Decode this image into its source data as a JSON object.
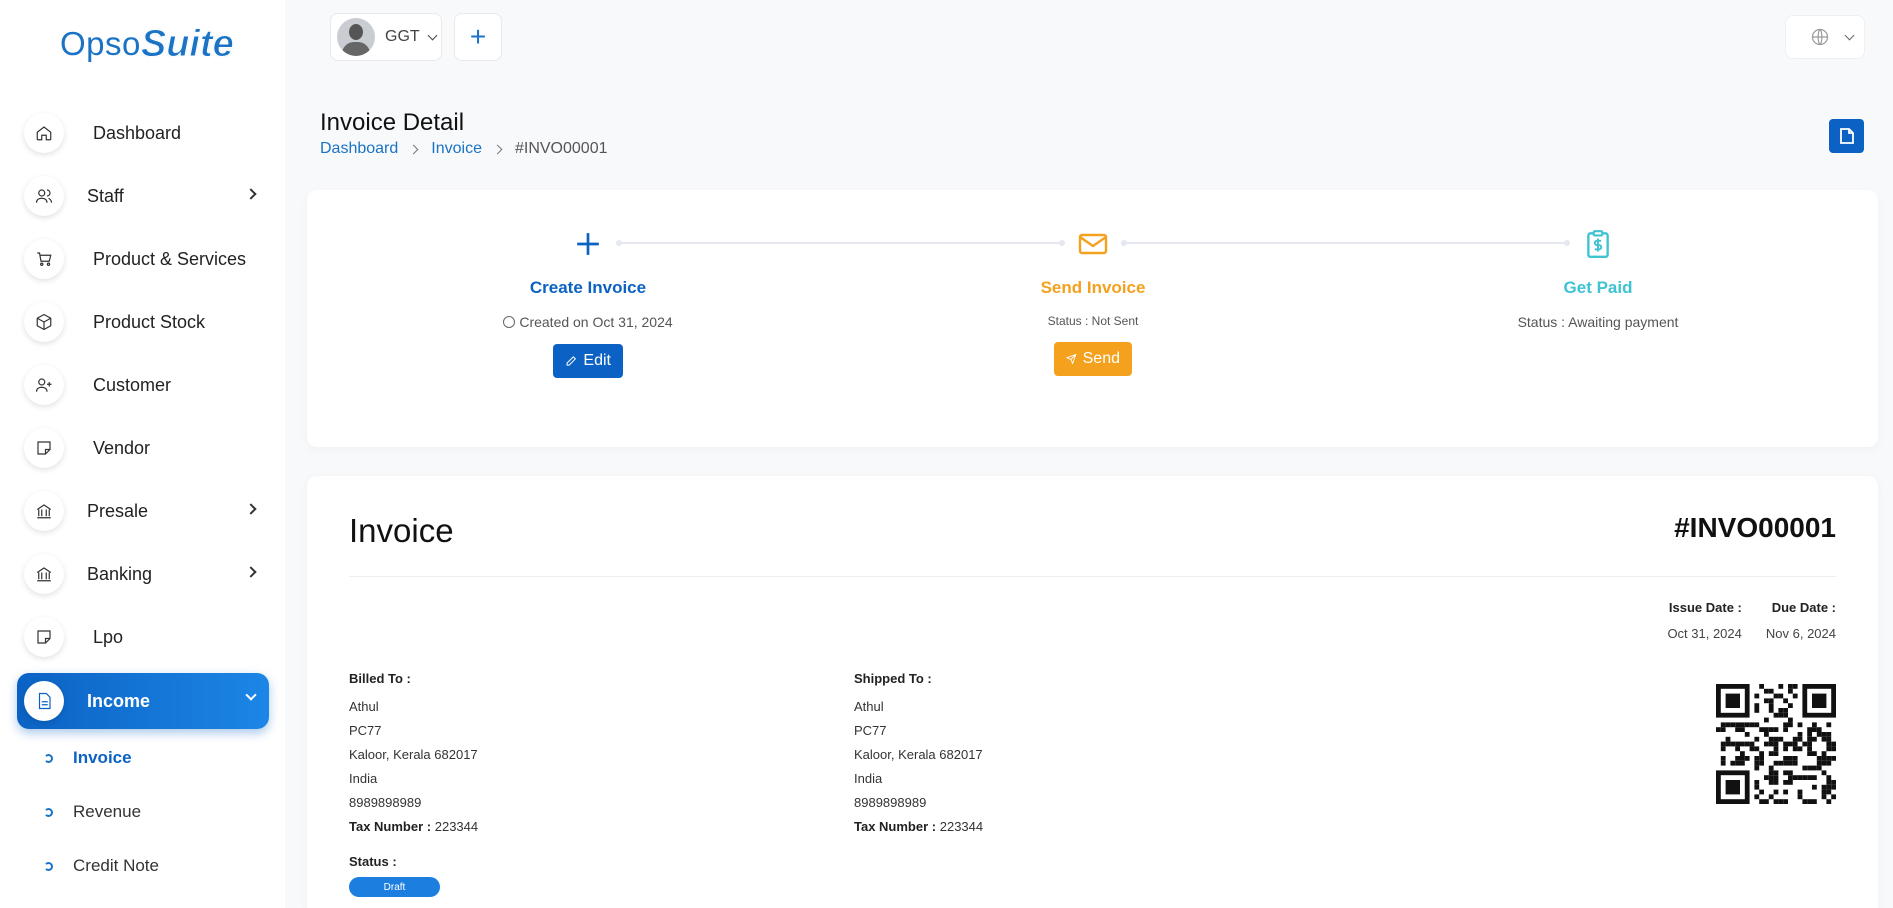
{
  "app": {
    "logo_part1": "Opso",
    "logo_part2": "Suite"
  },
  "topbar": {
    "company_name": "GGT",
    "add_label": "+"
  },
  "sidebar": {
    "items": [
      {
        "label": "Dashboard",
        "icon": "home-icon"
      },
      {
        "label": "Staff",
        "icon": "users-icon",
        "has_children": true
      },
      {
        "label": "Product & Services",
        "icon": "cart-icon"
      },
      {
        "label": "Product Stock",
        "icon": "box-icon"
      },
      {
        "label": "Customer",
        "icon": "user-plus-icon"
      },
      {
        "label": "Vendor",
        "icon": "note-icon"
      },
      {
        "label": "Presale",
        "icon": "bank-icon",
        "has_children": true
      },
      {
        "label": "Banking",
        "icon": "bank-icon",
        "has_children": true
      },
      {
        "label": "Lpo",
        "icon": "note-icon"
      },
      {
        "label": "Income",
        "icon": "file-icon",
        "has_children": true,
        "active": true
      }
    ],
    "subitems": [
      {
        "label": "Invoice",
        "active": true
      },
      {
        "label": "Revenue"
      },
      {
        "label": "Credit Note"
      }
    ]
  },
  "page": {
    "title": "Invoice Detail",
    "breadcrumb": [
      "Dashboard",
      "Invoice",
      "#INVO00001"
    ]
  },
  "progress": {
    "create": {
      "title": "Create Invoice",
      "info": "Created on Oct 31, 2024",
      "button": "Edit",
      "color": "#0b62c4"
    },
    "send": {
      "title": "Send Invoice",
      "info": "Status : Not Sent",
      "button": "Send",
      "color": "#f4a11e"
    },
    "paid": {
      "title": "Get Paid",
      "info": "Status : Awaiting payment",
      "color": "#3fc3d2"
    }
  },
  "invoice": {
    "title": "Invoice",
    "number": "#INVO00001",
    "issue_date_label": "Issue Date :",
    "issue_date": "Oct 31, 2024",
    "due_date_label": "Due Date :",
    "due_date": "Nov 6, 2024",
    "billed": {
      "heading": "Billed To :",
      "name": "Athul",
      "line1": "PC77",
      "line2": "Kaloor, Kerala 682017",
      "country": "India",
      "phone": "8989898989",
      "tax_label": "Tax Number :",
      "tax": "223344"
    },
    "shipped": {
      "heading": "Shipped To :",
      "name": "Athul",
      "line1": "PC77",
      "line2": "Kaloor, Kerala 682017",
      "country": "India",
      "phone": "8989898989",
      "tax_label": "Tax Number :",
      "tax": "223344"
    },
    "status_label": "Status :",
    "status": "Draft"
  }
}
